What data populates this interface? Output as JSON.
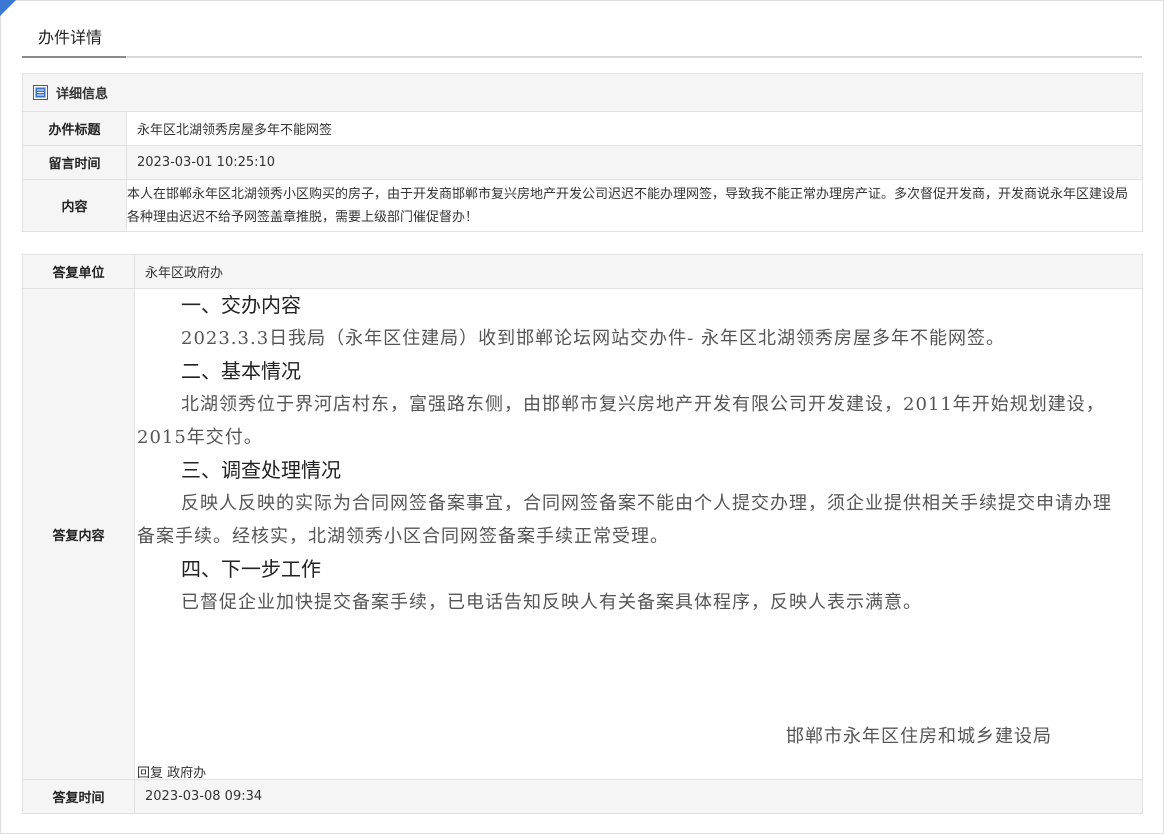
{
  "tab": {
    "label": "办件详情"
  },
  "details": {
    "header": "详细信息",
    "rows": [
      {
        "label": "办件标题",
        "value": "永年区北湖领秀房屋多年不能网签"
      },
      {
        "label": "留言时间",
        "value": "2023-03-01 10:25:10"
      },
      {
        "label": "内容",
        "value": "本人在邯郸永年区北湖领秀小区购买的房子，由于开发商邯郸市复兴房地产开发公司迟迟不能办理网签，导致我不能正常办理房产证。多次督促开发商，开发商说永年区建设局各种理由迟迟不给予网签盖章推脱，需要上级部门催促督办！"
      }
    ]
  },
  "reply": {
    "unit_label": "答复单位",
    "unit_value": "永年区政府办",
    "content_label": "答复内容",
    "h1": "一、交办内容",
    "p1": "2023.3.3日我局（永年区住建局）收到邯郸论坛网站交办件- 永年区北湖领秀房屋多年不能网签。",
    "h2": "二、基本情况",
    "p2": "北湖领秀位于界河店村东，富强路东侧，由邯郸市复兴房地产开发有限公司开发建设，2011年开始规划建设，2015年交付。",
    "h3": "三、调查处理情况",
    "p3": "反映人反映的实际为合同网签备案事宜，合同网签备案不能由个人提交办理，须企业提供相关手续提交申请办理备案手续。经核实，北湖领秀小区合同网签备案手续正常受理。",
    "h4": "四、下一步工作",
    "p4": "已督促企业加快提交备案手续，已电话告知反映人有关备案具体程序，反映人表示满意。",
    "signature": "邯郸市永年区住房和城乡建设局",
    "reply_by": "回复 政府办",
    "time_label": "答复时间",
    "time_value": "2023-03-08 09:34"
  }
}
